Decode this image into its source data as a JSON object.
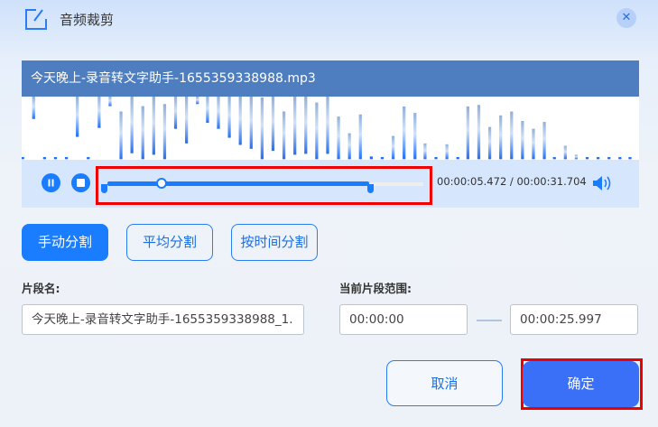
{
  "dialog": {
    "title": "音频裁剪",
    "close_icon": "close-icon"
  },
  "player": {
    "file_name": "今天晚上-录音转文字助手-1655359338988.mp3",
    "current_time": "00:00:05.472",
    "separator": "/",
    "total_time": "00:00:31.704",
    "playhead_fraction": 0.173,
    "range_start_fraction": 0,
    "range_end_fraction": 0.82
  },
  "split_modes": [
    {
      "label": "手动分割",
      "active": true
    },
    {
      "label": "平均分割",
      "active": false
    },
    {
      "label": "按时间分割",
      "active": false
    }
  ],
  "segment": {
    "name_label": "片段名:",
    "name_value": "今天晚上-录音转文字助手-1655359338988_1.",
    "range_label": "当前片段范围:",
    "start": "00:00:00",
    "end": "00:00:25.997"
  },
  "actions": {
    "cancel": "取消",
    "confirm": "确定"
  },
  "colors": {
    "accent": "#1a7cff",
    "header": "#4e7ebf",
    "confirm": "#3a6ff7",
    "highlight": "#ee0000"
  }
}
